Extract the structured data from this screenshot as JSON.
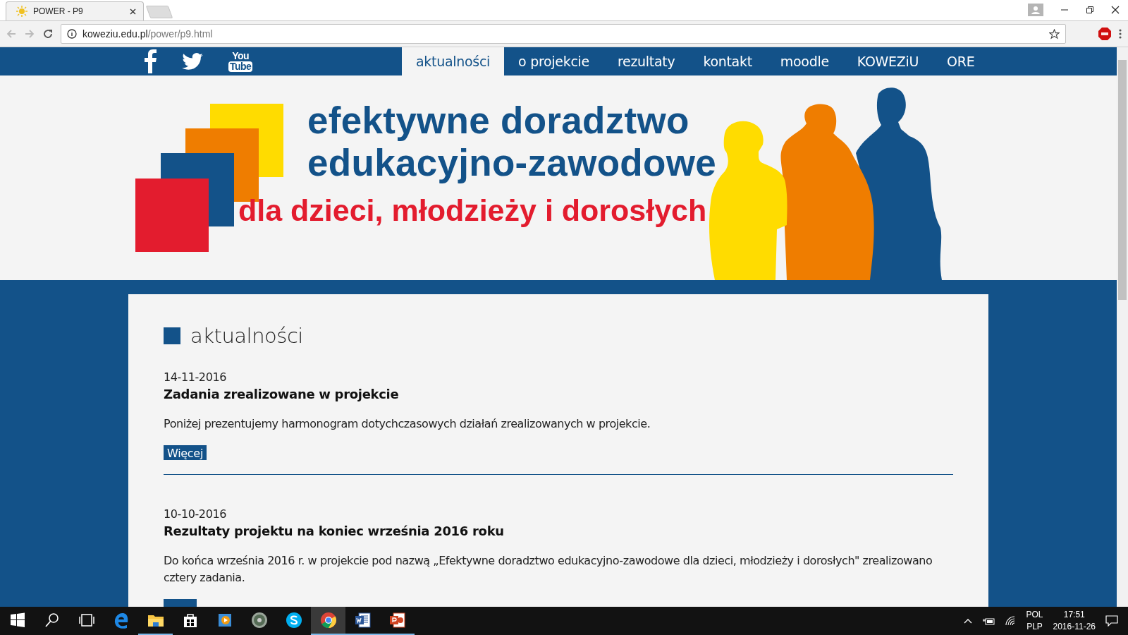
{
  "browser": {
    "tab": {
      "title": "POWER - P9"
    },
    "address": {
      "host": "koweziu.edu.pl",
      "path": "/power/p9.html"
    }
  },
  "nav": {
    "social": [
      {
        "kind": "facebook"
      },
      {
        "kind": "twitter"
      },
      {
        "kind": "youtube",
        "lines": [
          "You",
          "Tube"
        ]
      }
    ],
    "items": [
      {
        "label": "aktualności",
        "selected": true
      },
      {
        "label": "o projekcie",
        "selected": false
      },
      {
        "label": "rezultaty",
        "selected": false
      },
      {
        "label": "kontakt",
        "selected": false
      },
      {
        "label": "moodle",
        "selected": false
      },
      {
        "label": "KOWEZiU",
        "selected": false
      },
      {
        "label": "ORE",
        "selected": false
      }
    ]
  },
  "banner": {
    "headline": [
      "efektywne doradztwo",
      "edukacyjno-zawodowe"
    ],
    "tagline": "dla dzieci, młodzieży i dorosłych"
  },
  "section": {
    "title": "aktualności"
  },
  "news": [
    {
      "date": "14-11-2016",
      "title": "Zadania zrealizowane w projekcie",
      "summary": "Poniżej prezentujemy harmonogram dotychczasowych działań zrealizowanych w projekcie.",
      "more": "Więcej"
    },
    {
      "date": "10-10-2016",
      "title": "Rezultaty projektu na koniec września 2016 roku",
      "summary": "Do końca września 2016 r. w projekcie pod nazwą „Efektywne doradztwo edukacyjno-zawodowe dla dzieci, młodzieży i dorosłych\" zrealizowano cztery zadania."
    }
  ],
  "taskbar": {
    "apps": [
      {
        "kind": "start",
        "open": false,
        "selected": false
      },
      {
        "kind": "search",
        "open": false,
        "selected": false
      },
      {
        "kind": "task-view",
        "open": false,
        "selected": false
      },
      {
        "kind": "edge",
        "open": false,
        "selected": false
      },
      {
        "kind": "explorer",
        "open": true,
        "selected": false
      },
      {
        "kind": "store",
        "open": false,
        "selected": false
      },
      {
        "kind": "media",
        "open": false,
        "selected": false
      },
      {
        "kind": "disc",
        "open": false,
        "selected": false
      },
      {
        "kind": "skype",
        "open": false,
        "selected": false
      },
      {
        "kind": "chrome",
        "open": true,
        "selected": true
      },
      {
        "kind": "word",
        "open": true,
        "selected": false
      },
      {
        "kind": "powerpoint",
        "open": true,
        "selected": false
      }
    ],
    "tray": {
      "language": [
        "POL",
        "PLP"
      ],
      "time": "17:51",
      "date": "2016-11-26"
    }
  }
}
